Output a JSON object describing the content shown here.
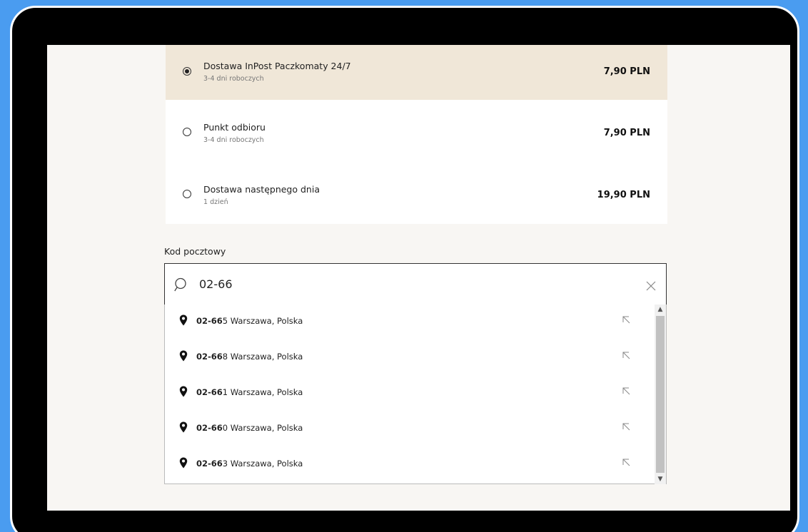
{
  "shipping": {
    "options": [
      {
        "title": "Dostawa InPost Paczkomaty 24/7",
        "subtitle": "3-4 dni roboczych",
        "price": "7,90 PLN",
        "selected": true
      },
      {
        "title": "Punkt odbioru",
        "subtitle": "3-4 dni roboczych",
        "price": "7,90 PLN",
        "selected": false
      },
      {
        "title": "Dostawa następnego dnia",
        "subtitle": "1 dzień",
        "price": "19,90 PLN",
        "selected": false
      }
    ]
  },
  "postal": {
    "label": "Kod pocztowy",
    "value": "02-66",
    "placeholder": ""
  },
  "suggestions": [
    {
      "match": "02-66",
      "rest": "5 Warszawa, Polska"
    },
    {
      "match": "02-66",
      "rest": "8 Warszawa, Polska"
    },
    {
      "match": "02-66",
      "rest": "1 Warszawa, Polska"
    },
    {
      "match": "02-66",
      "rest": "0 Warszawa, Polska"
    },
    {
      "match": "02-66",
      "rest": "3 Warszawa, Polska"
    }
  ],
  "icons": {
    "search": "search-icon",
    "clear": "close-icon",
    "pin": "map-pin-icon",
    "fill": "arrow-up-left-icon"
  },
  "colors": {
    "background": "#4a9cf0",
    "selected_option": "#f0e7d8",
    "page": "#f8f6f3"
  }
}
